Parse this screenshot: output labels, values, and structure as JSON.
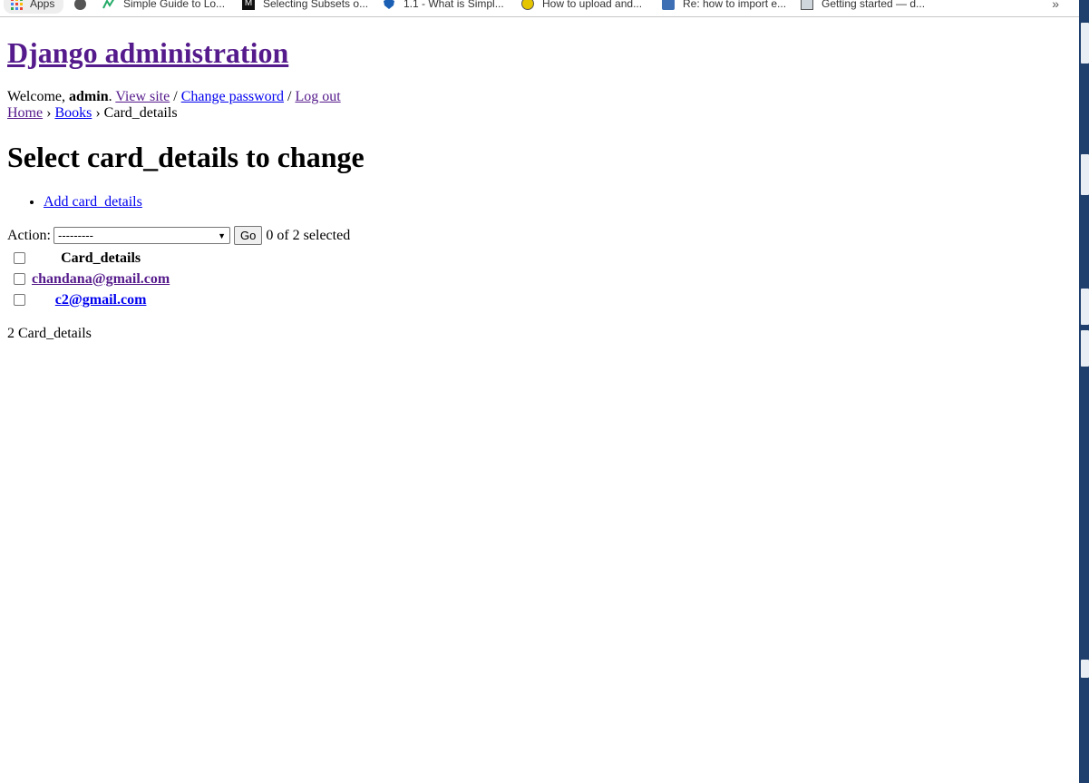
{
  "bookmarks": {
    "apps_label": "Apps",
    "items": [
      {
        "label": "Simple Guide to Lo...",
        "icon": "chart-line-icon"
      },
      {
        "label": "Selecting Subsets o...",
        "icon": "m-logo-icon"
      },
      {
        "label": "1.1 - What is Simpl...",
        "icon": "shield-icon"
      },
      {
        "label": "How to upload and...",
        "icon": "yellow-circle-icon"
      },
      {
        "label": "Re: how to import e...",
        "icon": "blue-cart-icon"
      },
      {
        "label": "Getting started — d...",
        "icon": "document-icon"
      }
    ],
    "overflow": "»"
  },
  "header": {
    "site_name": "Django administration",
    "welcome": "Welcome, ",
    "username": "admin",
    "period": ". ",
    "view_site": "View site",
    "sep1": " / ",
    "change_password": "Change password",
    "sep2": " / ",
    "logout": "Log out"
  },
  "breadcrumbs": {
    "home": "Home",
    "sep1": " › ",
    "app": "Books",
    "sep2": " › ",
    "current": "Card_details"
  },
  "main": {
    "title": "Select card_details to change",
    "add_link": "Add card_details",
    "actions": {
      "label": "Action:",
      "selected_option": "---------",
      "go": "Go",
      "counter": "0 of 2 selected"
    },
    "table": {
      "column_header": "Card_details",
      "rows": [
        {
          "value": "chandana@gmail.com"
        },
        {
          "value": "c2@gmail.com"
        }
      ]
    },
    "paginator": "2 Card_details"
  },
  "colors": {
    "link": "#0000ee",
    "visited_link": "#551a8b",
    "scrollbar": "#1f3f6c"
  }
}
